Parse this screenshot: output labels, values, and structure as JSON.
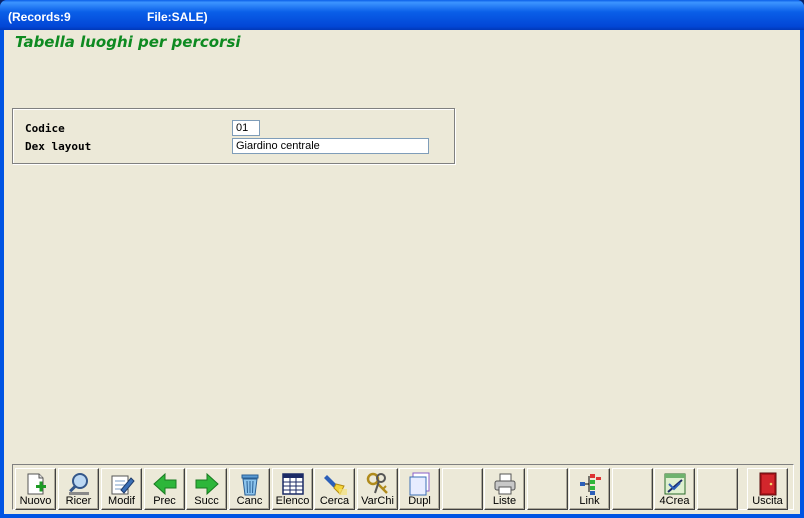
{
  "titlebar": {
    "records": "(Records:9",
    "file": "File:SALE)"
  },
  "form": {
    "title": "Tabella luoghi per percorsi",
    "fields": [
      {
        "label": "Codice",
        "value": "01"
      },
      {
        "label": "Dex layout",
        "value": "Giardino centrale"
      }
    ]
  },
  "toolbar": {
    "buttons": [
      {
        "label": "Nuovo",
        "icon": "new-document-icon"
      },
      {
        "label": "Ricer",
        "icon": "search-magnifier-icon"
      },
      {
        "label": "Modif",
        "icon": "edit-pencil-icon"
      },
      {
        "label": "Prec",
        "icon": "arrow-left-icon"
      },
      {
        "label": "Succ",
        "icon": "arrow-right-icon"
      },
      {
        "label": "Canc",
        "icon": "trash-icon"
      },
      {
        "label": "Elenco",
        "icon": "table-icon"
      },
      {
        "label": "Cerca",
        "icon": "flashlight-icon"
      },
      {
        "label": "VarChi",
        "icon": "keys-icon"
      },
      {
        "label": "Dupl",
        "icon": "duplicate-icon"
      },
      {
        "label": "",
        "icon": ""
      },
      {
        "label": "Liste",
        "icon": "printer-icon"
      },
      {
        "label": "",
        "icon": ""
      },
      {
        "label": "Link",
        "icon": "tree-icon"
      },
      {
        "label": "",
        "icon": ""
      },
      {
        "label": "4Crea",
        "icon": "build-icon"
      },
      {
        "label": "",
        "icon": ""
      },
      {
        "label": "Uscita",
        "icon": "exit-door-icon"
      }
    ]
  }
}
